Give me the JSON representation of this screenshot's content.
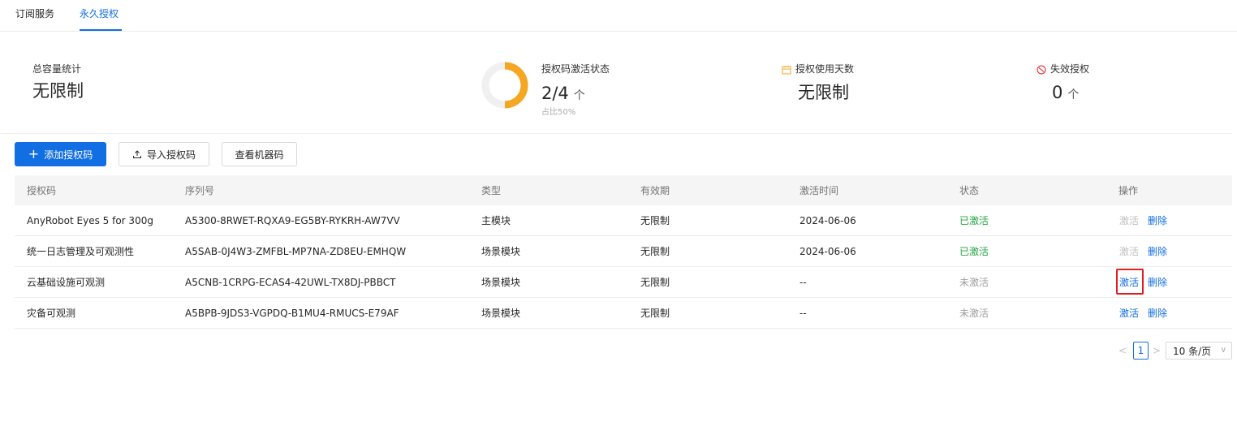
{
  "tabs": [
    {
      "label": "订阅服务",
      "active": false
    },
    {
      "label": "永久授权",
      "active": true
    }
  ],
  "stats": {
    "capacity": {
      "label": "总容量统计",
      "value": "无限制"
    },
    "activation": {
      "label": "授权码激活状态",
      "value": "2/4",
      "unit": "个",
      "sub": "占比50%",
      "ratio": 0.5
    },
    "days": {
      "label": "授权使用天数",
      "value": "无限制",
      "icon": "calendar-icon"
    },
    "invalid": {
      "label": "失效授权",
      "value": "0",
      "unit": "个",
      "icon": "stop-icon"
    }
  },
  "toolbar": {
    "add_label": "添加授权码",
    "import_label": "导入授权码",
    "machine_label": "查看机器码"
  },
  "table": {
    "headers": [
      "授权码",
      "序列号",
      "类型",
      "有效期",
      "激活时间",
      "状态",
      "操作"
    ],
    "rows": [
      {
        "code": "AnyRobot Eyes 5 for 300g",
        "serial": "A5300-8RWET-RQXA9-EG5BY-RYKRH-AW7VV",
        "type": "主模块",
        "validity": "无限制",
        "activated_at": "2024-06-06",
        "status": "已激活",
        "activate": "激活",
        "delete": "删除"
      },
      {
        "code": "统一日志管理及可观测性",
        "serial": "A5SAB-0J4W3-ZMFBL-MP7NA-ZD8EU-EMHQW",
        "type": "场景模块",
        "validity": "无限制",
        "activated_at": "2024-06-06",
        "status": "已激活",
        "activate": "激活",
        "delete": "删除"
      },
      {
        "code": "云基础设施可观测",
        "serial": "A5CNB-1CRPG-ECAS4-42UWL-TX8DJ-PBBCT",
        "type": "场景模块",
        "validity": "无限制",
        "activated_at": "--",
        "status": "未激活",
        "activate": "激活",
        "delete": "删除"
      },
      {
        "code": "灾备可观测",
        "serial": "A5BPB-9JDS3-VGPDQ-B1MU4-RMUCS-E79AF",
        "type": "场景模块",
        "validity": "无限制",
        "activated_at": "--",
        "status": "未激活",
        "activate": "激活",
        "delete": "删除"
      }
    ]
  },
  "pagination": {
    "prev": "<",
    "current": "1",
    "next": ">",
    "page_size": "10 条/页"
  },
  "colors": {
    "accent": "#126ee3",
    "donut": "#f5a623",
    "active": "#22a641",
    "highlight": "#e02020"
  }
}
